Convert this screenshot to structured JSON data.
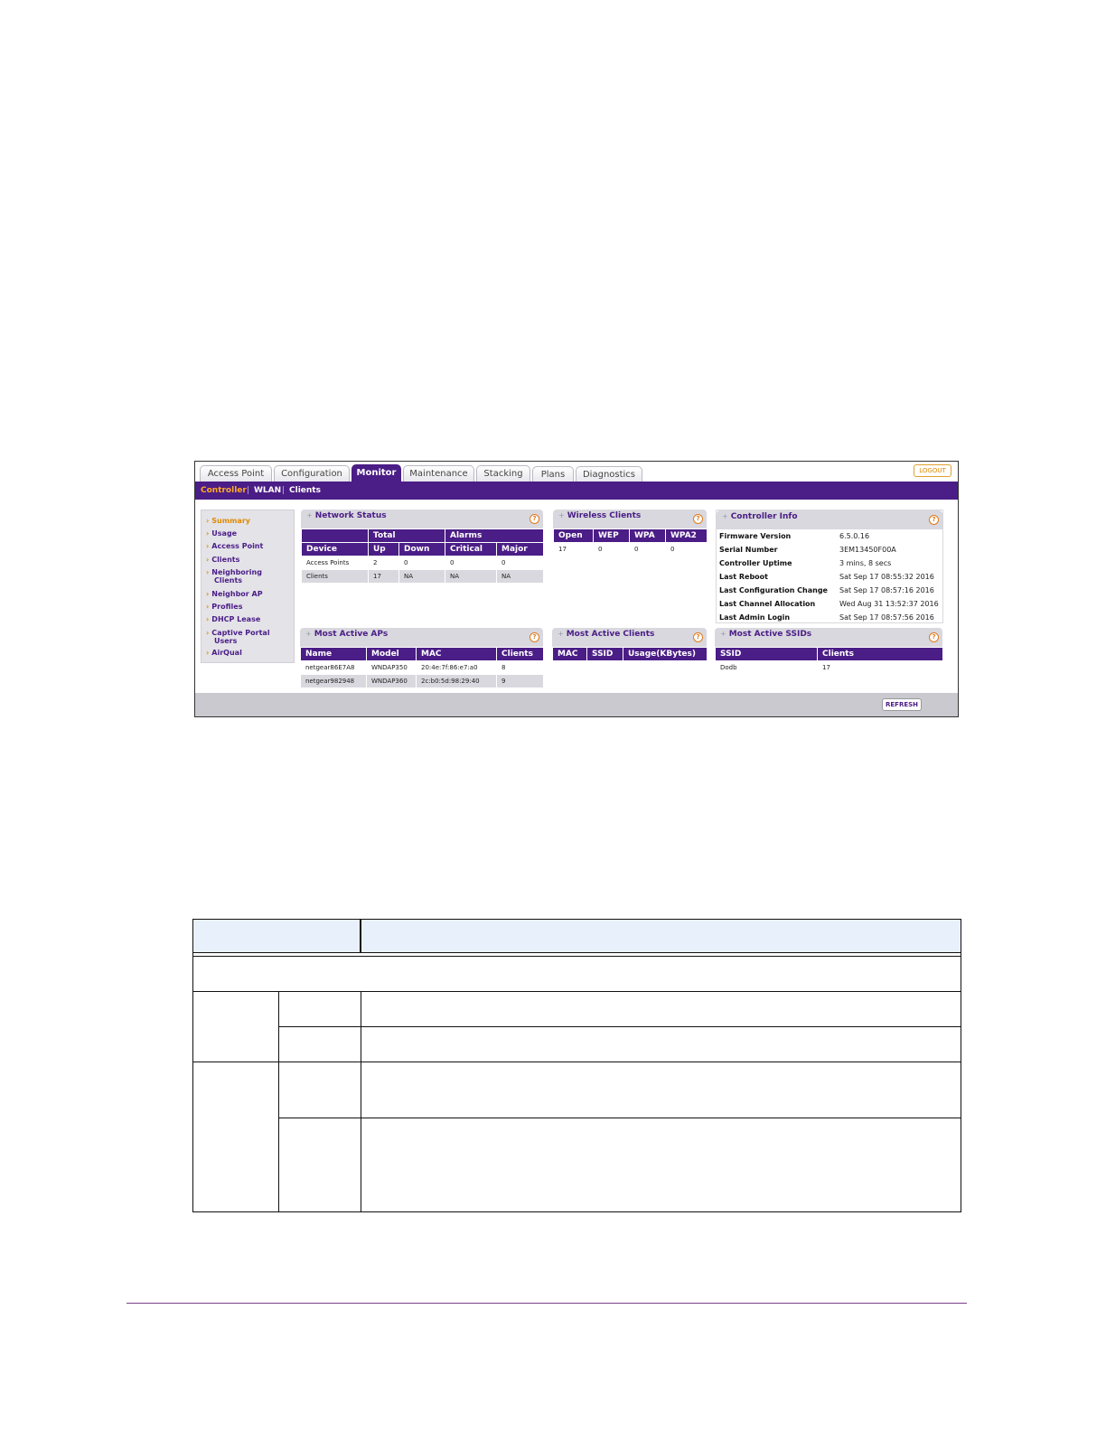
{
  "tabs": [
    "Access Point",
    "Configuration",
    "Monitor",
    "Maintenance",
    "Stacking",
    "Plans",
    "Diagnostics"
  ],
  "active_tab": "Monitor",
  "logout_label": "LOGOUT",
  "subnav": [
    "Controller",
    "WLAN",
    "Clients"
  ],
  "subnav_separator": "|",
  "sidebar": [
    "Summary",
    "Usage",
    "Access Point",
    "Clients",
    "Neighboring Clients",
    "Neighbor AP",
    "Profiles",
    "DHCP Lease",
    "Captive Portal Users",
    "AirQual"
  ],
  "network_status": {
    "title": "Network Status",
    "group_headers": [
      "",
      "Total",
      "Alarms"
    ],
    "headers": [
      "Device",
      "Up",
      "Down",
      "Critical",
      "Major"
    ],
    "rows": [
      [
        "Access Points",
        "2",
        "0",
        "0",
        "0"
      ],
      [
        "Clients",
        "17",
        "NA",
        "NA",
        "NA"
      ]
    ]
  },
  "wireless_clients": {
    "title": "Wireless Clients",
    "headers": [
      "Open",
      "WEP",
      "WPA",
      "WPA2"
    ],
    "rows": [
      [
        "17",
        "0",
        "0",
        "0"
      ]
    ]
  },
  "controller_info": {
    "title": "Controller Info",
    "rows": [
      [
        "Firmware Version",
        "6.5.0.16"
      ],
      [
        "Serial Number",
        "3EM13450F00A"
      ],
      [
        "Controller Uptime",
        "3 mins, 8 secs"
      ],
      [
        "Last Reboot",
        "Sat Sep 17 08:55:32 2016"
      ],
      [
        "Last Configuration Change",
        "Sat Sep 17 08:57:16 2016"
      ],
      [
        "Last Channel Allocation",
        "Wed Aug 31 13:52:37 2016"
      ],
      [
        "Last Admin Login",
        "Sat Sep 17 08:57:56 2016"
      ]
    ]
  },
  "most_active_aps": {
    "title": "Most Active APs",
    "headers": [
      "Name",
      "Model",
      "MAC",
      "Clients"
    ],
    "rows": [
      [
        "netgear86E7A8",
        "WNDAP350",
        "20:4e:7f:86:e7:a0",
        "8"
      ],
      [
        "netgear982948",
        "WNDAP360",
        "2c:b0:5d:98:29:40",
        "9"
      ]
    ]
  },
  "most_active_clients": {
    "title": "Most Active Clients",
    "headers": [
      "MAC",
      "SSID",
      "Usage(KBytes)"
    ]
  },
  "most_active_ssids": {
    "title": "Most Active SSIDs",
    "headers": [
      "SSID",
      "Clients"
    ],
    "rows": [
      [
        "Dodb",
        "17"
      ]
    ]
  },
  "refresh_label": "REFRESH",
  "panel_icons": {
    "expand": "+",
    "help": "?"
  },
  "colors": {
    "brand_purple": "#4b1d86",
    "accent_orange": "#e08a00",
    "panel_gray": "#d8d8de"
  }
}
